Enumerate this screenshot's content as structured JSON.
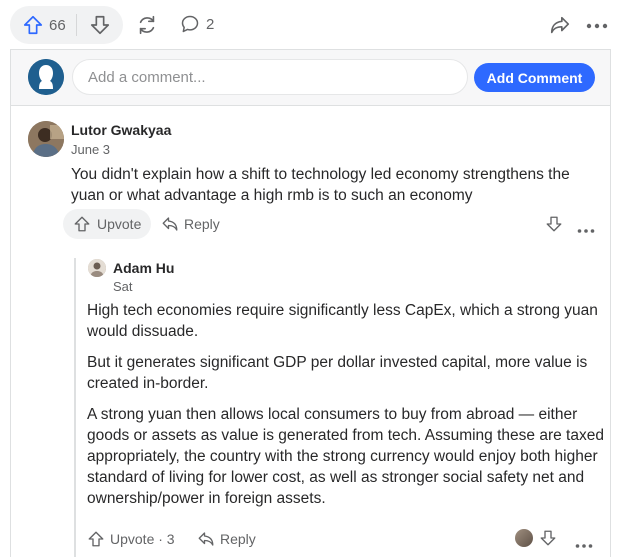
{
  "top_bar": {
    "upvote_count": "66",
    "comment_count": "2"
  },
  "add_comment": {
    "placeholder": "Add a comment...",
    "button_label": "Add Comment"
  },
  "comments": [
    {
      "author": "Lutor Gwakyaa",
      "date": "June 3",
      "text": "You didn't explain how a shift to technology led economy strengthens the yuan or what advantage a high rmb is to such an economy",
      "upvote_label": "Upvote",
      "reply_label": "Reply"
    },
    {
      "author": "Adam Hu",
      "date": "Sat",
      "paragraphs": [
        "High tech economies require significantly less CapEx, which a strong yuan would dissuade.",
        "But it generates significant GDP per dollar invested capital, more value is created in-border.",
        "A strong yuan then allows local consumers to buy from abroad — either goods or assets as value is generated from tech. Assuming these are taxed appropriately, the country with the strong currency would enjoy both higher standard of living for lower cost, as well as stronger social safety net and ownership/power in foreign assets."
      ],
      "upvote_label": "Upvote · 3",
      "reply_label": "Reply"
    }
  ],
  "colors": {
    "accent": "#2e69ff",
    "text": "#282829",
    "muted": "#636466",
    "border": "#dee0e1"
  }
}
